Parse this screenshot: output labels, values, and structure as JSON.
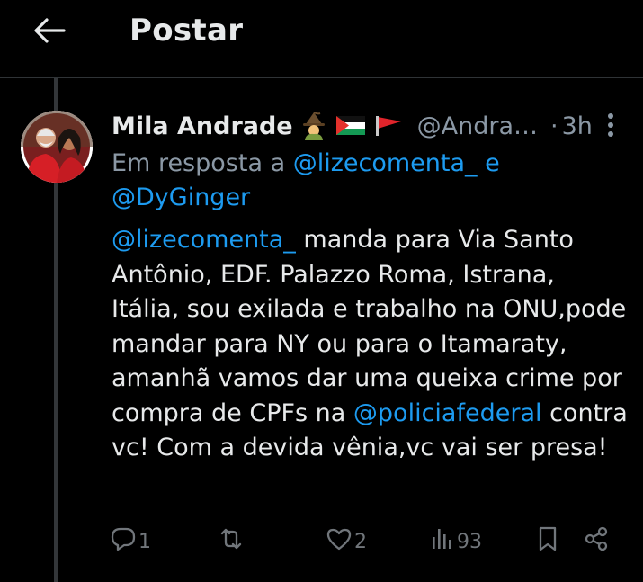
{
  "header": {
    "back_icon": "arrow-left-icon",
    "title": "Postar"
  },
  "post": {
    "author_name": "Mila Andrade",
    "author_emojis": [
      "witch-emoji",
      "palestine-flag-emoji",
      "red-flag-emoji"
    ],
    "handle": "@Andra…",
    "separator": "·",
    "time": "3h",
    "reply_prefix": "Em resposta a",
    "reply_mention_1": "@lizecomenta_",
    "reply_conjunction": "e",
    "reply_mention_2": "@DyGinger",
    "body": {
      "mention_start": "@lizecomenta_",
      "text_1": " manda para Via Santo Antônio, EDF. Palazzo Roma, Istrana, Itália, sou exilada e trabalho na ONU,pode mandar para NY ou para o Itamaraty, amanhã vamos dar uma queixa crime por compra de CPFs na ",
      "mention_mid": "@policiafederal",
      "text_2": " contra vc! Com a devida vênia,vc vai ser presa!"
    },
    "actions": {
      "replies": "1",
      "reposts": "",
      "likes": "2",
      "views": "93"
    }
  },
  "colors": {
    "background": "#000000",
    "text": "#e7e9ea",
    "secondary": "#8b98a5",
    "link": "#1d9bf0",
    "divider": "#2f3336"
  }
}
